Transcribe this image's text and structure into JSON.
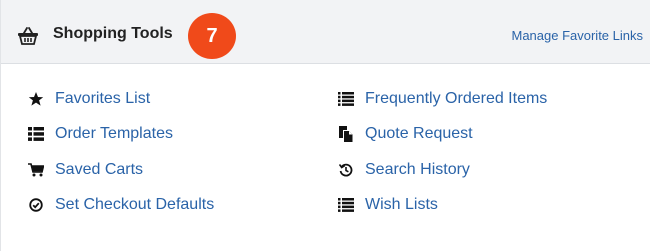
{
  "header": {
    "title": "Shopping Tools",
    "icon": "basket-icon",
    "badge_count": "7",
    "badge_color": "#f04a1a",
    "manage_link": "Manage Favorite Links"
  },
  "links": {
    "left": [
      {
        "label": "Favorites List",
        "icon": "star-icon"
      },
      {
        "label": "Order Templates",
        "icon": "list-icon"
      },
      {
        "label": "Saved Carts",
        "icon": "cart-icon"
      },
      {
        "label": "Set Checkout Defaults",
        "icon": "check-circle-icon"
      }
    ],
    "right": [
      {
        "label": "Frequently Ordered Items",
        "icon": "list-icon"
      },
      {
        "label": "Quote Request",
        "icon": "copy-document-icon"
      },
      {
        "label": "Search History",
        "icon": "history-icon"
      },
      {
        "label": "Wish Lists",
        "icon": "list-icon"
      }
    ]
  },
  "colors": {
    "link": "#2a63a8",
    "header_bg": "#f2f3f5"
  }
}
